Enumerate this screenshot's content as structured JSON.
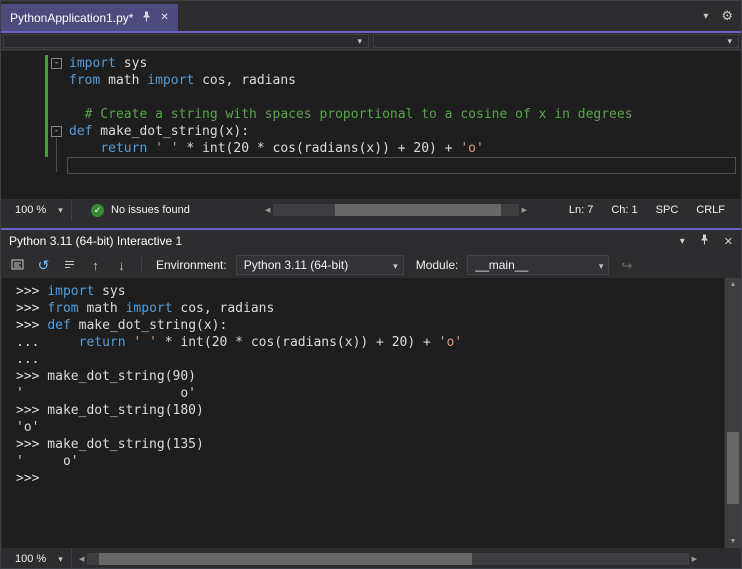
{
  "colors": {
    "accent": "#6a61c8",
    "tab-active": "#4d4a7d",
    "keyword": "#569cd6",
    "string": "#d69d85",
    "comment": "#57a64a",
    "code-text": "#dcdcdc",
    "change-green": "#44a036",
    "check-green": "#388a34"
  },
  "icons": {
    "minus": "-",
    "chevron_down": "▾",
    "close": "✕",
    "gear": "⚙",
    "check": "✓",
    "reset": "↺",
    "arrow_up": "↑",
    "arrow_down": "↓",
    "scroll_left": "◀",
    "scroll_right": "▶",
    "scroll_up": "▲",
    "scroll_down": "▼",
    "send_arrow": "↪"
  },
  "editor": {
    "tab_title": "PythonApplication1.py*",
    "status": {
      "zoom": "100 %",
      "issues_text": "No issues found",
      "line": "Ln: 7",
      "column": "Ch: 1",
      "spaces": "SPC",
      "line_ending": "CRLF"
    },
    "code_lines": [
      {
        "fold": true,
        "tokens": [
          [
            "kw",
            "import"
          ],
          [
            "txt",
            " sys"
          ]
        ]
      },
      {
        "tokens": [
          [
            "kw",
            "from"
          ],
          [
            "txt",
            " math "
          ],
          [
            "kw",
            "import"
          ],
          [
            "txt",
            " cos, radians"
          ]
        ]
      },
      {
        "tokens": []
      },
      {
        "tokens": [
          [
            "txt",
            "  "
          ],
          [
            "com",
            "# Create a string with spaces proportional to a cosine of x in degrees"
          ]
        ]
      },
      {
        "fold": true,
        "tokens": [
          [
            "kw",
            "def"
          ],
          [
            "txt",
            " make_dot_string(x):"
          ]
        ]
      },
      {
        "tokens": [
          [
            "txt",
            "    "
          ],
          [
            "kw",
            "return"
          ],
          [
            "txt",
            " "
          ],
          [
            "str",
            "' '"
          ],
          [
            "txt",
            " * int(20 * cos(radians(x)) + 20) + "
          ],
          [
            "str",
            "'o'"
          ]
        ]
      },
      {
        "caret": true,
        "tokens": []
      }
    ]
  },
  "interactive": {
    "title": "Python 3.11 (64-bit) Interactive 1",
    "toolbar": {
      "environment_label": "Environment:",
      "environment_value": "Python 3.11 (64-bit)",
      "module_label": "Module:",
      "module_value": "__main__"
    },
    "repl_lines": [
      {
        "tokens": [
          [
            "txt",
            ">>> "
          ],
          [
            "kw",
            "import"
          ],
          [
            "txt",
            " sys"
          ]
        ]
      },
      {
        "tokens": [
          [
            "txt",
            ">>> "
          ],
          [
            "kw",
            "from"
          ],
          [
            "txt",
            " math "
          ],
          [
            "kw",
            "import"
          ],
          [
            "txt",
            " cos, radians"
          ]
        ]
      },
      {
        "tokens": [
          [
            "txt",
            ">>> "
          ],
          [
            "kw",
            "def"
          ],
          [
            "txt",
            " make_dot_string(x):"
          ]
        ]
      },
      {
        "tokens": [
          [
            "txt",
            "...     "
          ],
          [
            "kw",
            "return"
          ],
          [
            "txt",
            " "
          ],
          [
            "str",
            "' '"
          ],
          [
            "txt",
            " * int(20 * cos(radians(x)) + 20) + "
          ],
          [
            "str",
            "'o'"
          ]
        ]
      },
      {
        "tokens": [
          [
            "txt",
            "..."
          ]
        ]
      },
      {
        "tokens": [
          [
            "txt",
            ">>> make_dot_string(90)"
          ]
        ]
      },
      {
        "tokens": [
          [
            "txt",
            "'                    o'"
          ]
        ]
      },
      {
        "tokens": [
          [
            "txt",
            ">>> make_dot_string(180)"
          ]
        ]
      },
      {
        "tokens": [
          [
            "txt",
            "'o'"
          ]
        ]
      },
      {
        "tokens": [
          [
            "txt",
            ">>> make_dot_string(135)"
          ]
        ]
      },
      {
        "tokens": [
          [
            "txt",
            "'     o'"
          ]
        ]
      },
      {
        "tokens": [
          [
            "txt",
            ">>> "
          ]
        ]
      }
    ],
    "status_zoom": "100 %"
  }
}
